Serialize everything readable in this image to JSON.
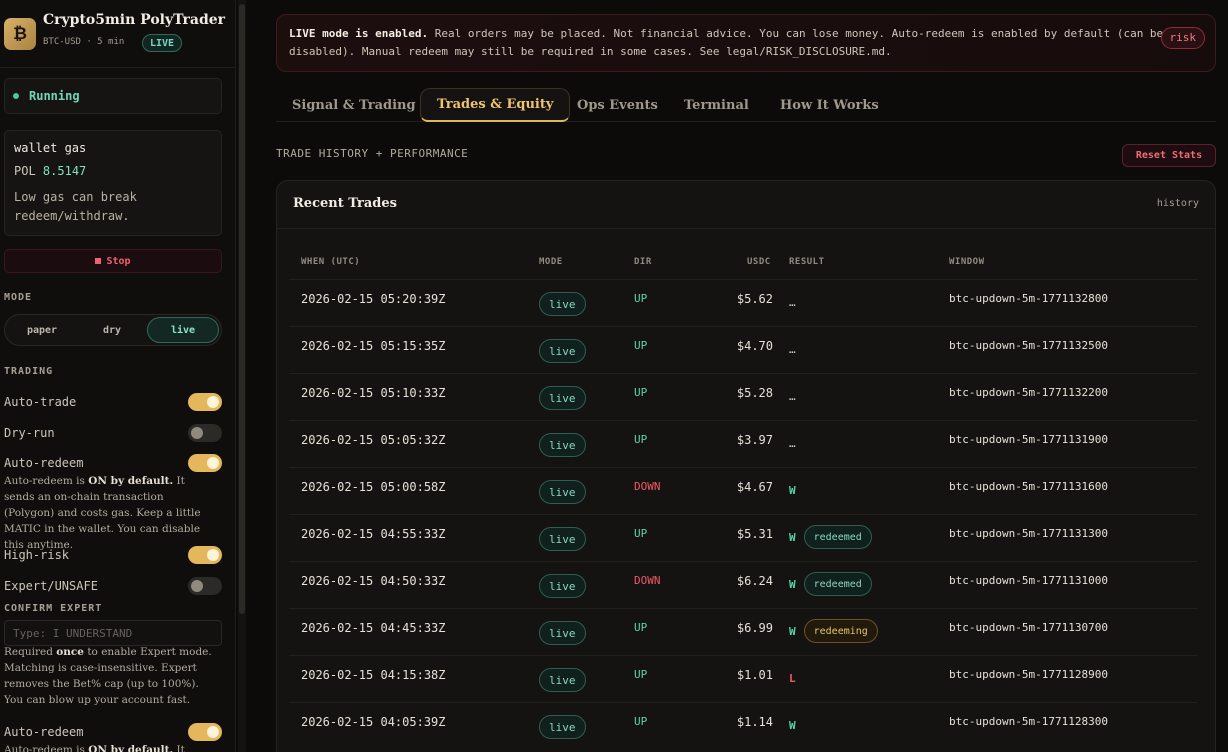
{
  "brand": {
    "logo_glyph": "₿",
    "title": "Crypto5min PolyTrader",
    "subtitle": "BTC-USD · 5 min",
    "mode_badge": "LIVE"
  },
  "status": {
    "label": "Running"
  },
  "gas": {
    "title": "wallet gas",
    "currency": "POL",
    "value": "8.5147",
    "note": "Low gas can break redeem/withdraw."
  },
  "stop_button": "Stop",
  "mode": {
    "label": "MODE",
    "options": [
      "paper",
      "dry",
      "live"
    ],
    "selected": "live"
  },
  "trading": {
    "label": "TRADING",
    "toggles": [
      {
        "label": "Auto-trade",
        "on": true
      },
      {
        "label": "Dry-run",
        "on": false
      },
      {
        "label": "Auto-redeem",
        "on": true
      },
      {
        "label": "High-risk",
        "on": true
      },
      {
        "label": "Expert/UNSAFE",
        "on": false
      },
      {
        "label": "Auto-redeem",
        "on": true
      }
    ],
    "auto_redeem_help": {
      "prefix": "Auto-redeem is ",
      "strong": "ON by default.",
      "suffix": " It sends an on-chain transaction (Polygon) and costs gas. Keep a little MATIC in the wallet. You can disable this anytime."
    },
    "confirm_label": "CONFIRM EXPERT",
    "confirm_placeholder": "Type: I UNDERSTAND",
    "confirm_help": {
      "prefix": "Required ",
      "strong": "once",
      "suffix": " to enable Expert mode. Matching is case-insensitive. Expert removes the Bet% cap (up to 100%). You can blow up your account fast."
    },
    "auto_redeem_help_2": {
      "prefix": "Auto-redeem is ",
      "strong": "ON by default.",
      "suffix": " It sends"
    }
  },
  "banner": {
    "strong": "LIVE mode is enabled.",
    "text": " Real orders may be placed. Not financial advice. You can lose money. Auto-redeem is enabled by default (can be disabled). Manual redeem may still be required in some cases. See legal/RISK_DISCLOSURE.md.",
    "badge": "risk"
  },
  "tabs": [
    {
      "label": "Signal & Trading",
      "active": false
    },
    {
      "label": "Trades & Equity",
      "active": true
    },
    {
      "label": "Ops Events",
      "active": false
    },
    {
      "label": "Terminal",
      "active": false
    },
    {
      "label": "How It Works",
      "active": false
    }
  ],
  "section": {
    "title": "TRADE HISTORY + PERFORMANCE",
    "reset_label": "Reset Stats"
  },
  "trades": {
    "title": "Recent Trades",
    "hint": "history",
    "columns": [
      "WHEN (UTC)",
      "MODE",
      "DIR",
      "USDC",
      "RESULT",
      "WINDOW"
    ],
    "rows": [
      {
        "when": "2026-02-15 05:20:39Z",
        "mode": "live",
        "dir": "UP",
        "usdc": "$5.62",
        "result": "…",
        "status": "",
        "window": "btc-updown-5m-1771132800"
      },
      {
        "when": "2026-02-15 05:15:35Z",
        "mode": "live",
        "dir": "UP",
        "usdc": "$4.70",
        "result": "…",
        "status": "",
        "window": "btc-updown-5m-1771132500"
      },
      {
        "when": "2026-02-15 05:10:33Z",
        "mode": "live",
        "dir": "UP",
        "usdc": "$5.28",
        "result": "…",
        "status": "",
        "window": "btc-updown-5m-1771132200"
      },
      {
        "when": "2026-02-15 05:05:32Z",
        "mode": "live",
        "dir": "UP",
        "usdc": "$3.97",
        "result": "…",
        "status": "",
        "window": "btc-updown-5m-1771131900"
      },
      {
        "when": "2026-02-15 05:00:58Z",
        "mode": "live",
        "dir": "DOWN",
        "usdc": "$4.67",
        "result": "W",
        "status": "",
        "window": "btc-updown-5m-1771131600"
      },
      {
        "when": "2026-02-15 04:55:33Z",
        "mode": "live",
        "dir": "UP",
        "usdc": "$5.31",
        "result": "W",
        "status": "redeemed",
        "window": "btc-updown-5m-1771131300"
      },
      {
        "when": "2026-02-15 04:50:33Z",
        "mode": "live",
        "dir": "DOWN",
        "usdc": "$6.24",
        "result": "W",
        "status": "redeemed",
        "window": "btc-updown-5m-1771131000"
      },
      {
        "when": "2026-02-15 04:45:33Z",
        "mode": "live",
        "dir": "UP",
        "usdc": "$6.99",
        "result": "W",
        "status": "redeeming",
        "window": "btc-updown-5m-1771130700"
      },
      {
        "when": "2026-02-15 04:15:38Z",
        "mode": "live",
        "dir": "UP",
        "usdc": "$1.01",
        "result": "L",
        "status": "",
        "window": "btc-updown-5m-1771128900"
      },
      {
        "when": "2026-02-15 04:05:39Z",
        "mode": "live",
        "dir": "UP",
        "usdc": "$1.14",
        "result": "W",
        "status": "",
        "window": "btc-updown-5m-1771128300"
      }
    ]
  }
}
